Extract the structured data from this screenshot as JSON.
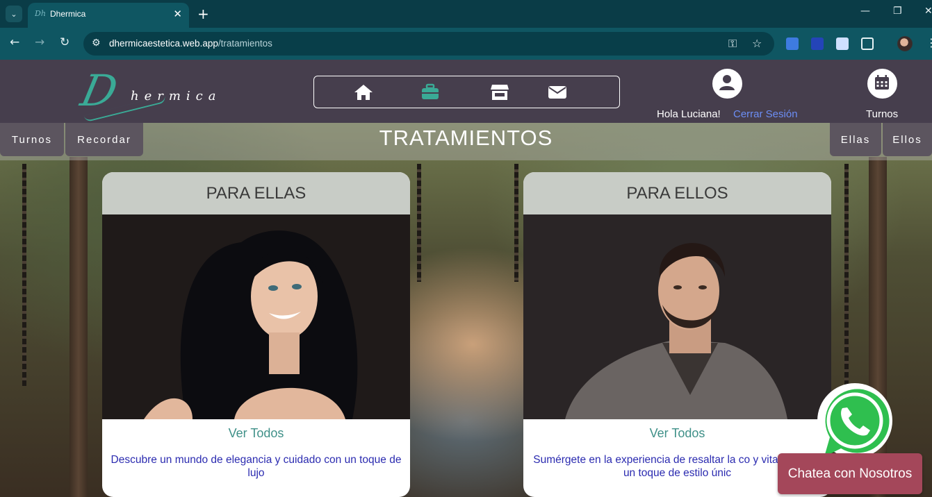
{
  "browser": {
    "tab_title": "Dhermica",
    "url_host": "dhermicaestetica.web.app",
    "url_path": "/tratamientos",
    "tab_close": "✕",
    "new_tab": "+"
  },
  "site": {
    "logo_initial": "D",
    "logo_rest": "hermica",
    "nav": [
      {
        "icon": "home-icon",
        "active": false
      },
      {
        "icon": "briefcase-icon",
        "active": true
      },
      {
        "icon": "store-icon",
        "active": false
      },
      {
        "icon": "envelope-icon",
        "active": false
      }
    ],
    "greeting": "Hola Luciana!",
    "logout": "Cerrar Sesión",
    "appointments_label": "Turnos",
    "accent_color": "#3aaa96"
  },
  "subnav": {
    "left": [
      "Turnos",
      "Recordar"
    ],
    "right": [
      "Ellas",
      "Ellos"
    ],
    "title": "TRATAMIENTOS"
  },
  "cards": [
    {
      "title": "PARA ELLAS",
      "link": "Ver Todos",
      "description": "Descubre un mundo de elegancia y cuidado con un toque de lujo"
    },
    {
      "title": "PARA ELLOS",
      "link": "Ver Todos",
      "description": "Sumérgete en la experiencia de resaltar la co y vitalidad con un toque de estilo únic"
    }
  ],
  "chat": {
    "label": "Chatea con Nosotros",
    "color": "#a4475a"
  }
}
